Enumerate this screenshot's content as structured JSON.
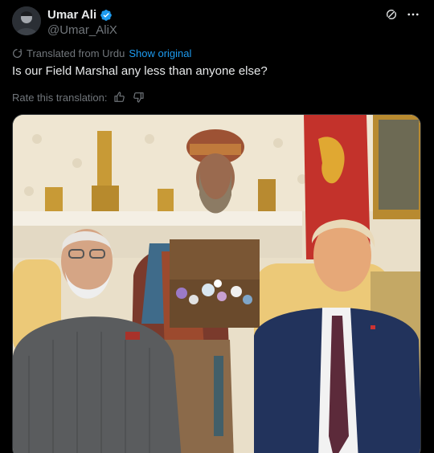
{
  "author": {
    "display_name": "Umar Ali",
    "handle": "@Umar_AliX"
  },
  "translation": {
    "label": "Translated from Urdu",
    "show_original": "Show original"
  },
  "tweet": {
    "text": "Is our Field Marshal any less than anyone else?"
  },
  "rating": {
    "label": "Rate this translation:"
  },
  "icons": {
    "verified": "verified-badge-icon",
    "grok": "grok-icon",
    "more": "more-icon",
    "translate": "translate-icon",
    "thumbs_up": "thumbs-up-icon",
    "thumbs_down": "thumbs-down-icon"
  },
  "colors": {
    "accent": "#1d9bf0",
    "muted": "#71767b",
    "text": "#e7e9ea"
  }
}
